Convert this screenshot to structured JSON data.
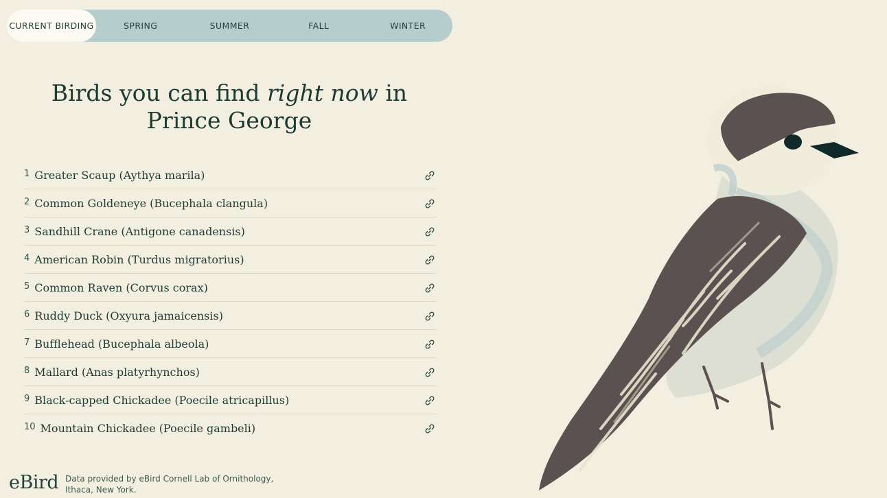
{
  "tabs": [
    {
      "label": "CURRENT BIRDING"
    },
    {
      "label": "SPRING"
    },
    {
      "label": "SUMMER"
    },
    {
      "label": "FALL"
    },
    {
      "label": "WINTER"
    }
  ],
  "headline": {
    "before": "Birds you can find ",
    "emphasis": "right now",
    "after": " in Prince George"
  },
  "species": [
    {
      "rank": "1",
      "name": "Greater Scaup (Aythya marila)"
    },
    {
      "rank": "2",
      "name": "Common Goldeneye (Bucephala clangula)"
    },
    {
      "rank": "3",
      "name": "Sandhill Crane (Antigone canadensis)"
    },
    {
      "rank": "4",
      "name": "American Robin (Turdus migratorius)"
    },
    {
      "rank": "5",
      "name": "Common Raven (Corvus corax)"
    },
    {
      "rank": "6",
      "name": "Ruddy Duck (Oxyura jamaicensis)"
    },
    {
      "rank": "7",
      "name": "Bufflehead (Bucephala albeola)"
    },
    {
      "rank": "8",
      "name": "Mallard (Anas platyrhynchos)"
    },
    {
      "rank": "9",
      "name": "Black-capped Chickadee (Poecile atricapillus)"
    },
    {
      "rank": "10",
      "name": "Mountain Chickadee (Poecile gambeli)"
    }
  ],
  "footer": {
    "logo": "eBird",
    "credit": "Data provided by eBird Cornell Lab of Ornithology, Ithaca, New York."
  },
  "icons": {
    "row_action": "link-icon",
    "illustration": "chickadee-illustration"
  },
  "colors": {
    "background": "#f3efe0",
    "tab_bar": "#b5cdcc",
    "tab_active": "#fbfaf3",
    "text": "#1d3a33",
    "bird_dark": "#5b5150",
    "bird_light": "#dcdfd2"
  }
}
